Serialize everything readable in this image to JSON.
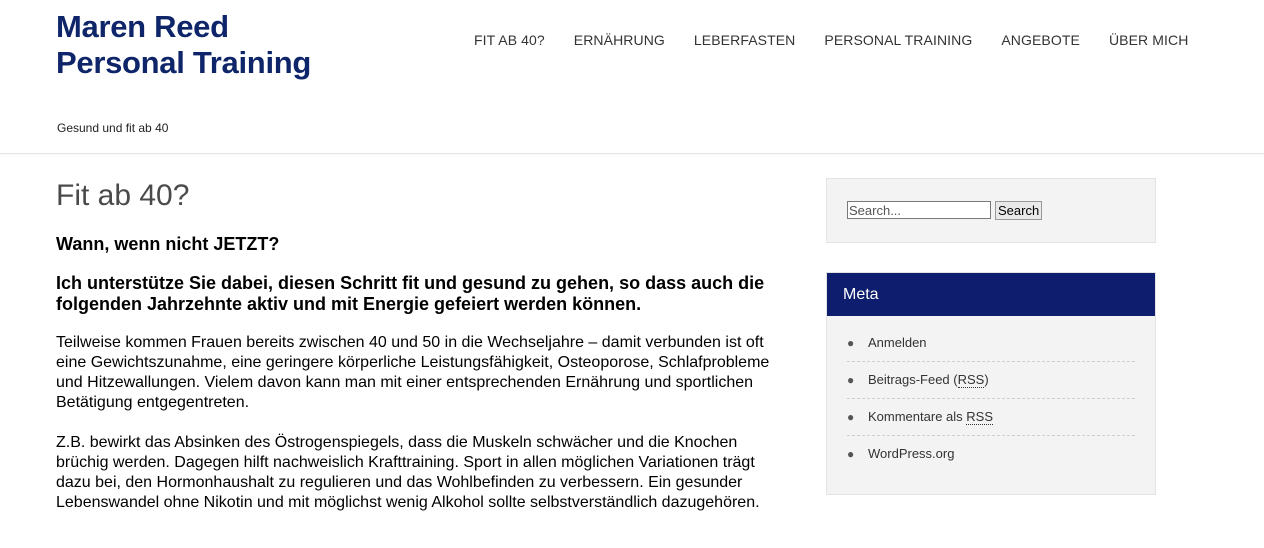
{
  "header": {
    "site_title": "Maren Reed Personal Training",
    "tagline": "Gesund und fit ab 40",
    "title_color": "#0f2569"
  },
  "nav": {
    "items": [
      {
        "label": "FIT AB 40?"
      },
      {
        "label": "ERNÄHRUNG"
      },
      {
        "label": "LEBERFASTEN"
      },
      {
        "label": "PERSONAL TRAINING"
      },
      {
        "label": "ANGEBOTE"
      },
      {
        "label": "ÜBER MICH"
      }
    ]
  },
  "main": {
    "page_title": "Fit ab 40?",
    "heading_1": "Wann, wenn nicht JETZT?",
    "heading_2": "Ich unterstütze Sie dabei, diesen Schritt fit und gesund zu gehen, so dass auch die folgenden Jahrzehnte aktiv und mit Energie gefeiert werden können.",
    "paragraph_1": "Teilweise kommen Frauen bereits zwischen 40 und 50 in die Wechseljahre – damit verbunden ist oft eine Gewichtszunahme, eine geringere körperliche Leistungsfähigkeit, Osteoporose, Schlafprobleme und Hitzewallungen. Vielem davon kann man mit einer entsprechenden Ernährung und sportlichen Betätigung entgegentreten.",
    "paragraph_2": "Z.B. bewirkt das Absinken des Östrogenspiegels, dass die Muskeln schwächer und die Knochen brüchig werden. Dagegen hilft nachweislich Krafttraining. Sport in allen möglichen Variationen trägt dazu bei, den Hormonhaushalt zu regulieren und das Wohlbefinden zu verbessern. Ein gesunder Lebenswandel ohne Nikotin und mit möglichst wenig Alkohol sollte selbstverständlich dazugehören."
  },
  "sidebar": {
    "search": {
      "placeholder": "Search...",
      "value": "",
      "button_label": "Search"
    },
    "meta": {
      "title": "Meta",
      "title_bg": "#0f1d6e",
      "items": [
        {
          "label": "Anmelden"
        },
        {
          "label_pre": "Beitrags-Feed (",
          "label_abbr": "RSS",
          "label_post": ")"
        },
        {
          "label_pre": "Kommentare als ",
          "label_abbr": "RSS",
          "label_post": ""
        },
        {
          "label": "WordPress.org"
        }
      ]
    }
  }
}
